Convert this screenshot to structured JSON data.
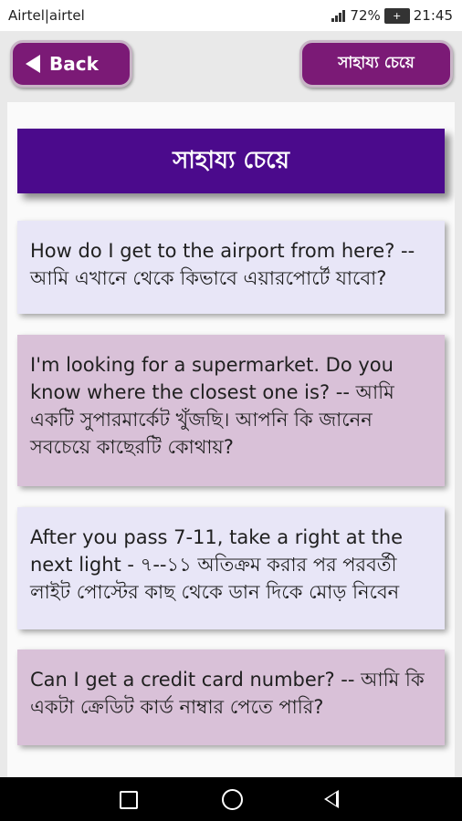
{
  "status_bar": {
    "carrier": "Airtel|airtel",
    "battery_percent": "72%",
    "time": "21:45",
    "icons": [
      "signal-icon",
      "battery-charging-icon"
    ]
  },
  "header": {
    "back_label": "Back",
    "help_label": "সাহায্য চেয়ে"
  },
  "page": {
    "title": "সাহায্য চেয়ে"
  },
  "phrases": [
    {
      "text": "How do I get to the airport from here? -- আমি এখানে থেকে কিভাবে এয়ারপোর্টে যাবো?"
    },
    {
      "text": "I'm looking for a supermarket. Do you know where the closest one is? -- আমি একটি সুপারমার্কেট খুঁজছি। আপনি কি জানেন সবচেয়ে কাছেরটি কোথায়?"
    },
    {
      "text": "After you pass 7-11, take a right at the next light - ৭--১১ অতিক্রম করার পর পরবর্তী লাইট পোস্টের কাছ থেকে ডান দিকে মোড় নিবেন"
    },
    {
      "text": "Can I get a credit card number? -- আমি কি একটা ক্রেডিট কার্ড নাম্বার পেতে পারি?"
    }
  ],
  "colors": {
    "header_button": "#7b1a76",
    "title_banner": "#4b0a8c",
    "card_light": "#e8e6f7",
    "card_mauve": "#d9c1d8"
  },
  "nav_bar": {
    "icons": [
      "recent-apps-icon",
      "home-icon",
      "back-icon"
    ]
  }
}
